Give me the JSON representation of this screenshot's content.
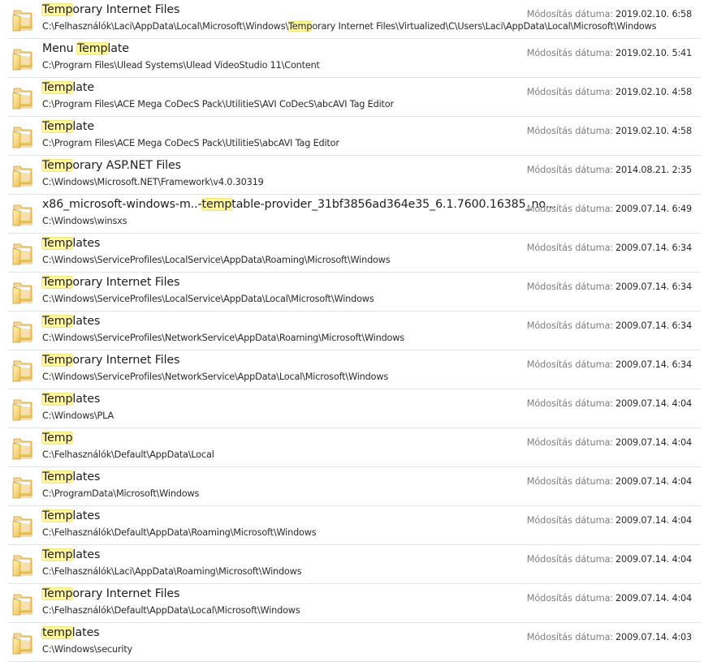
{
  "search_results": [
    {
      "name_parts": [
        {
          "text": "Temp",
          "hl": true
        },
        {
          "text": "orary Internet Files",
          "hl": false
        }
      ],
      "path_parts": [
        {
          "text": "C:\\Felhasználók\\Laci\\AppData\\Local\\Microsoft\\Windows\\",
          "hl": false
        },
        {
          "text": "Temp",
          "hl": true
        },
        {
          "text": "orary Internet Files\\Virtualized\\C\\Users\\Laci\\AppData\\Local\\Microsoft\\Windows",
          "hl": false
        }
      ],
      "date_label": "Módosítás dátuma:",
      "date_value": "2019.02.10. 6:58"
    },
    {
      "name_parts": [
        {
          "text": "Menu ",
          "hl": false
        },
        {
          "text": "Temp",
          "hl": true
        },
        {
          "text": "late",
          "hl": false
        }
      ],
      "path_parts": [
        {
          "text": "C:\\Program Files\\Ulead Systems\\Ulead VideoStudio 11\\Content",
          "hl": false
        }
      ],
      "date_label": "Módosítás dátuma:",
      "date_value": "2019.02.10. 5:41"
    },
    {
      "name_parts": [
        {
          "text": "Temp",
          "hl": true
        },
        {
          "text": "late",
          "hl": false
        }
      ],
      "path_parts": [
        {
          "text": "C:\\Program Files\\ACE Mega CoDecS Pack\\UtilitieS\\AVI CoDecS\\abcAVI Tag Editor",
          "hl": false
        }
      ],
      "date_label": "Módosítás dátuma:",
      "date_value": "2019.02.10. 4:58"
    },
    {
      "name_parts": [
        {
          "text": "Temp",
          "hl": true
        },
        {
          "text": "late",
          "hl": false
        }
      ],
      "path_parts": [
        {
          "text": "C:\\Program Files\\ACE Mega CoDecS Pack\\UtilitieS\\abcAVI Tag Editor",
          "hl": false
        }
      ],
      "date_label": "Módosítás dátuma:",
      "date_value": "2019.02.10. 4:58"
    },
    {
      "name_parts": [
        {
          "text": "Temp",
          "hl": true
        },
        {
          "text": "orary ASP.NET Files",
          "hl": false
        }
      ],
      "path_parts": [
        {
          "text": "C:\\Windows\\Microsoft.NET\\Framework\\v4.0.30319",
          "hl": false
        }
      ],
      "date_label": "Módosítás dátuma:",
      "date_value": "2014.08.21. 2:35"
    },
    {
      "name_parts": [
        {
          "text": "x86_microsoft-windows-m..-",
          "hl": false
        },
        {
          "text": "temp",
          "hl": true
        },
        {
          "text": "table-provider_31bf3856ad364e35_6.1.7600.16385_no...",
          "hl": false
        }
      ],
      "path_parts": [
        {
          "text": "C:\\Windows\\winsxs",
          "hl": false
        }
      ],
      "date_label": "Módosítás dátuma:",
      "date_value": "2009.07.14. 6:49"
    },
    {
      "name_parts": [
        {
          "text": "Temp",
          "hl": true
        },
        {
          "text": "lates",
          "hl": false
        }
      ],
      "path_parts": [
        {
          "text": "C:\\Windows\\ServiceProfiles\\LocalService\\AppData\\Roaming\\Microsoft\\Windows",
          "hl": false
        }
      ],
      "date_label": "Módosítás dátuma:",
      "date_value": "2009.07.14. 6:34"
    },
    {
      "name_parts": [
        {
          "text": "Temp",
          "hl": true
        },
        {
          "text": "orary Internet Files",
          "hl": false
        }
      ],
      "path_parts": [
        {
          "text": "C:\\Windows\\ServiceProfiles\\LocalService\\AppData\\Local\\Microsoft\\Windows",
          "hl": false
        }
      ],
      "date_label": "Módosítás dátuma:",
      "date_value": "2009.07.14. 6:34"
    },
    {
      "name_parts": [
        {
          "text": "Temp",
          "hl": true
        },
        {
          "text": "lates",
          "hl": false
        }
      ],
      "path_parts": [
        {
          "text": "C:\\Windows\\ServiceProfiles\\NetworkService\\AppData\\Roaming\\Microsoft\\Windows",
          "hl": false
        }
      ],
      "date_label": "Módosítás dátuma:",
      "date_value": "2009.07.14. 6:34"
    },
    {
      "name_parts": [
        {
          "text": "Temp",
          "hl": true
        },
        {
          "text": "orary Internet Files",
          "hl": false
        }
      ],
      "path_parts": [
        {
          "text": "C:\\Windows\\ServiceProfiles\\NetworkService\\AppData\\Local\\Microsoft\\Windows",
          "hl": false
        }
      ],
      "date_label": "Módosítás dátuma:",
      "date_value": "2009.07.14. 6:34"
    },
    {
      "name_parts": [
        {
          "text": "Temp",
          "hl": true
        },
        {
          "text": "lates",
          "hl": false
        }
      ],
      "path_parts": [
        {
          "text": "C:\\Windows\\PLA",
          "hl": false
        }
      ],
      "date_label": "Módosítás dátuma:",
      "date_value": "2009.07.14. 4:04"
    },
    {
      "name_parts": [
        {
          "text": "Temp",
          "hl": true
        }
      ],
      "path_parts": [
        {
          "text": "C:\\Felhasználók\\Default\\AppData\\Local",
          "hl": false
        }
      ],
      "date_label": "Módosítás dátuma:",
      "date_value": "2009.07.14. 4:04"
    },
    {
      "name_parts": [
        {
          "text": "Temp",
          "hl": true
        },
        {
          "text": "lates",
          "hl": false
        }
      ],
      "path_parts": [
        {
          "text": "C:\\ProgramData\\Microsoft\\Windows",
          "hl": false
        }
      ],
      "date_label": "Módosítás dátuma:",
      "date_value": "2009.07.14. 4:04"
    },
    {
      "name_parts": [
        {
          "text": "Temp",
          "hl": true
        },
        {
          "text": "lates",
          "hl": false
        }
      ],
      "path_parts": [
        {
          "text": "C:\\Felhasználók\\Default\\AppData\\Roaming\\Microsoft\\Windows",
          "hl": false
        }
      ],
      "date_label": "Módosítás dátuma:",
      "date_value": "2009.07.14. 4:04"
    },
    {
      "name_parts": [
        {
          "text": "Temp",
          "hl": true
        },
        {
          "text": "lates",
          "hl": false
        }
      ],
      "path_parts": [
        {
          "text": "C:\\Felhasználók\\Laci\\AppData\\Roaming\\Microsoft\\Windows",
          "hl": false
        }
      ],
      "date_label": "Módosítás dátuma:",
      "date_value": "2009.07.14. 4:04"
    },
    {
      "name_parts": [
        {
          "text": "Temp",
          "hl": true
        },
        {
          "text": "orary Internet Files",
          "hl": false
        }
      ],
      "path_parts": [
        {
          "text": "C:\\Felhasználók\\Default\\AppData\\Local\\Microsoft\\Windows",
          "hl": false
        }
      ],
      "date_label": "Módosítás dátuma:",
      "date_value": "2009.07.14. 4:04"
    },
    {
      "name_parts": [
        {
          "text": "temp",
          "hl": true
        },
        {
          "text": "lates",
          "hl": false
        }
      ],
      "path_parts": [
        {
          "text": "C:\\Windows\\security",
          "hl": false
        }
      ],
      "date_label": "Módosítás dátuma:",
      "date_value": "2009.07.14. 4:03"
    }
  ],
  "icons": {
    "item_icon": "folder-icon"
  },
  "colors": {
    "highlight": "#fff79a",
    "date_label": "#7d7d7d",
    "separator": "#e3e3e3"
  }
}
